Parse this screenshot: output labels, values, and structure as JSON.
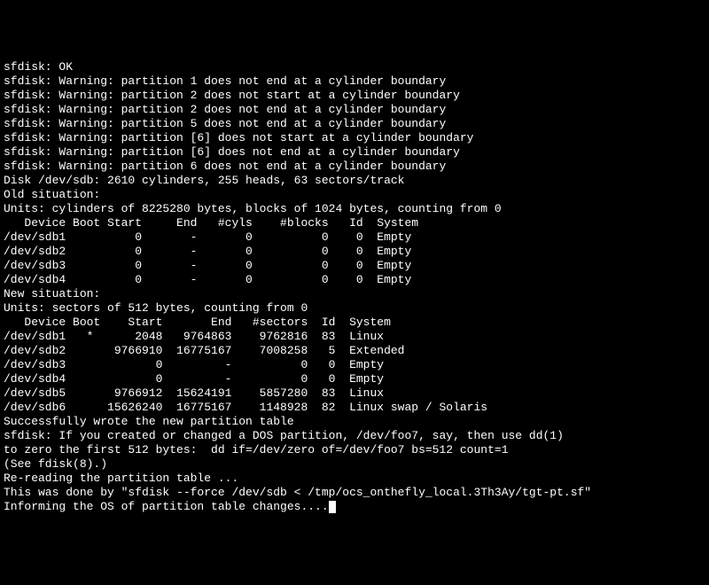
{
  "lines": {
    "l00": "sfdisk: OK",
    "l01": "sfdisk: Warning: partition 1 does not end at a cylinder boundary",
    "l02": "sfdisk: Warning: partition 2 does not start at a cylinder boundary",
    "l03": "sfdisk: Warning: partition 2 does not end at a cylinder boundary",
    "l04": "sfdisk: Warning: partition 5 does not end at a cylinder boundary",
    "l05": "sfdisk: Warning: partition [6] does not start at a cylinder boundary",
    "l06": "sfdisk: Warning: partition [6] does not end at a cylinder boundary",
    "l07": "sfdisk: Warning: partition 6 does not end at a cylinder boundary",
    "l08": "",
    "l09": "Disk /dev/sdb: 2610 cylinders, 255 heads, 63 sectors/track",
    "l10": "Old situation:",
    "l11": "Units: cylinders of 8225280 bytes, blocks of 1024 bytes, counting from 0",
    "l12": "",
    "l13": "   Device Boot Start     End   #cyls    #blocks   Id  System",
    "l14": "/dev/sdb1          0       -       0          0    0  Empty",
    "l15": "/dev/sdb2          0       -       0          0    0  Empty",
    "l16": "/dev/sdb3          0       -       0          0    0  Empty",
    "l17": "/dev/sdb4          0       -       0          0    0  Empty",
    "l18": "New situation:",
    "l19": "Units: sectors of 512 bytes, counting from 0",
    "l20": "",
    "l21": "   Device Boot    Start       End   #sectors  Id  System",
    "l22": "/dev/sdb1   *      2048   9764863    9762816  83  Linux",
    "l23": "/dev/sdb2       9766910  16775167    7008258   5  Extended",
    "l24": "/dev/sdb3             0         -          0   0  Empty",
    "l25": "/dev/sdb4             0         -          0   0  Empty",
    "l26": "/dev/sdb5       9766912  15624191    5857280  83  Linux",
    "l27": "/dev/sdb6      15626240  16775167    1148928  82  Linux swap / Solaris",
    "l28": "Successfully wrote the new partition table",
    "l29": "",
    "l30": "sfdisk: If you created or changed a DOS partition, /dev/foo7, say, then use dd(1)",
    "l31": "to zero the first 512 bytes:  dd if=/dev/zero of=/dev/foo7 bs=512 count=1",
    "l32": "(See fdisk(8).)",
    "l33": "Re-reading the partition table ...",
    "l34": "",
    "l35": "This was done by \"sfdisk --force /dev/sdb < /tmp/ocs_onthefly_local.3Th3Ay/tgt-pt.sf\"",
    "l36": "Informing the OS of partition table changes...."
  }
}
